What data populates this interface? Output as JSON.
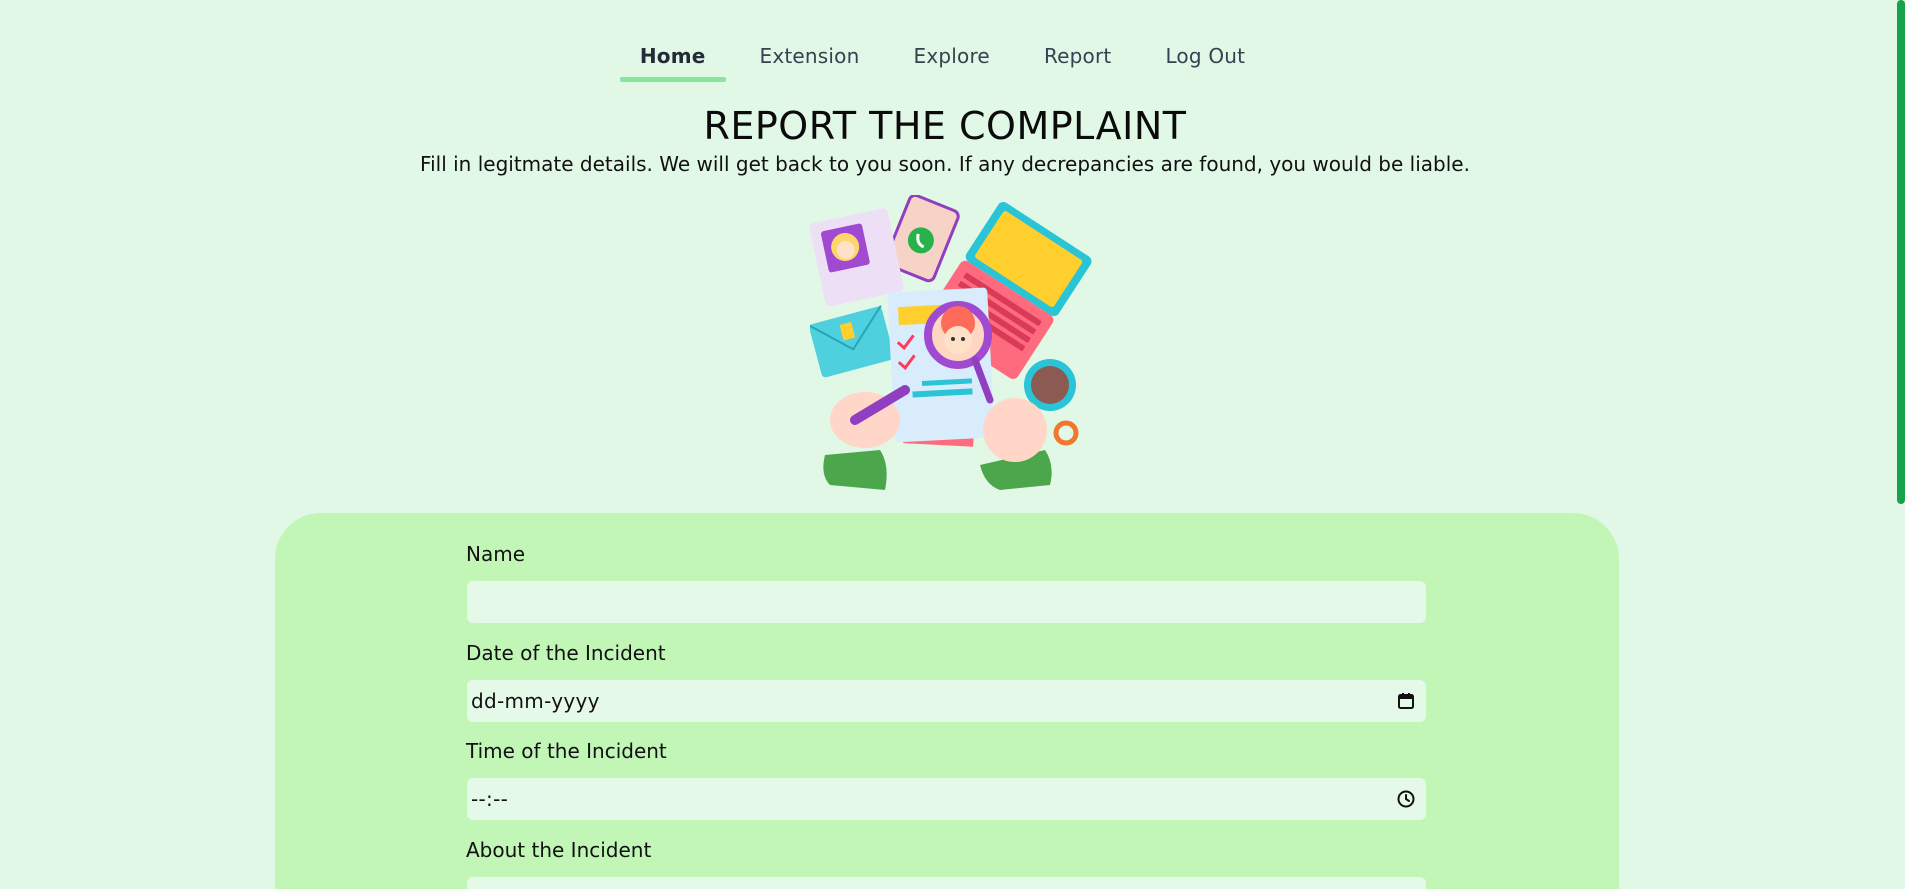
{
  "nav": {
    "items": [
      {
        "label": "Home",
        "active": true
      },
      {
        "label": "Extension",
        "active": false
      },
      {
        "label": "Explore",
        "active": false
      },
      {
        "label": "Report",
        "active": false
      },
      {
        "label": "Log Out",
        "active": false
      }
    ]
  },
  "header": {
    "title": "REPORT THE COMPLAINT",
    "subtitle": "Fill in legitmate details. We will get back to you soon. If any decrepancies are found, you would be liable."
  },
  "form": {
    "name_label": "Name",
    "name_value": "",
    "date_label": "Date of the Incident",
    "date_placeholder": "dd-mm-yyyy",
    "time_label": "Time of the Incident",
    "time_placeholder": "--:--",
    "about_label": "About the Incident"
  },
  "colors": {
    "background": "#e2f8e6",
    "card": "#c1f6b7",
    "input": "#e4f9e8",
    "nav_active_underline": "#86e59e",
    "scrollbar": "#16a34a"
  },
  "icons": {
    "date_input": "calendar-icon",
    "time_input": "clock-icon"
  }
}
